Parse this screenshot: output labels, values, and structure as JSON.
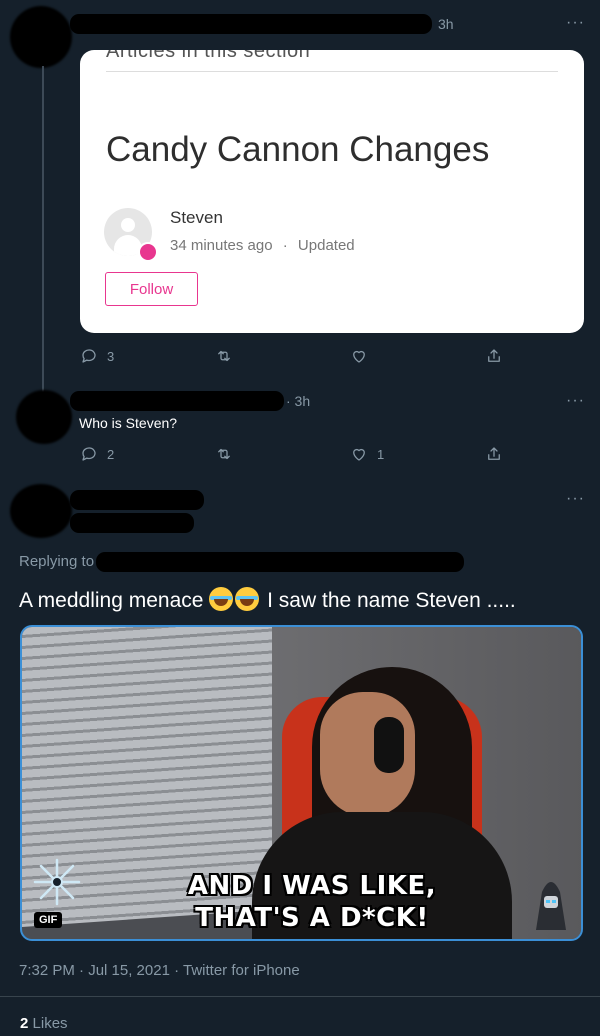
{
  "tweet1": {
    "time": "3h",
    "more": "···",
    "card": {
      "heading_cut": "Articles in this section",
      "title": "Candy Cannon Changes",
      "author": "Steven",
      "time_ago": "34 minutes ago",
      "separator": "·",
      "updated": "Updated",
      "follow_label": "Follow"
    },
    "actions": {
      "replies": "3",
      "retweets": "",
      "likes": ""
    }
  },
  "tweet2": {
    "time": "· 3h",
    "more": "···",
    "text": "Who is Steven?",
    "actions": {
      "replies": "2",
      "retweets": "",
      "likes": "1"
    }
  },
  "tweet3": {
    "more": "···",
    "replying_to": "Replying to",
    "text_before": "A meddling menace ",
    "text_after": " I saw the name Steven .....",
    "gif": {
      "caption_line1": "AND I WAS LIKE,",
      "caption_line2": "THAT'S A D*CK!",
      "badge": "GIF"
    },
    "timestamp": "7:32 PM · Jul 15, 2021 · Twitter for iPhone",
    "likes_count": "2",
    "likes_label": "Likes"
  },
  "colors": {
    "background": "#15202b",
    "muted": "#8899a6",
    "accent_pink": "#e8368f",
    "gif_border": "#3b8fd6"
  },
  "icons": [
    "reply-icon",
    "retweet-icon",
    "like-icon",
    "share-icon",
    "more-icon"
  ]
}
